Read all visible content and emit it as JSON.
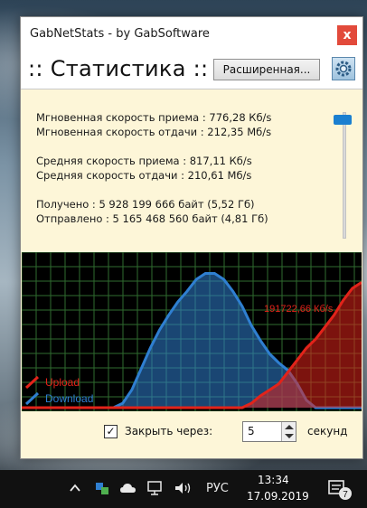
{
  "window": {
    "title": "GabNetStats - by GabSoftware",
    "close_glyph": "x",
    "heading": ":: Статистика ::",
    "advanced_button": "Расширенная..."
  },
  "stats": {
    "instant_rx": "Мгновенная скорость приема : 776,28 Кб/s",
    "instant_tx": "Мгновенная скорость отдачи : 212,35 Мб/s",
    "avg_rx": "Средняя скорость приема : 817,11 Кб/s",
    "avg_tx": "Средняя скорость отдачи : 210,61 Мб/s",
    "received": "Получено : 5 928 199 666 байт (5,52 Гб)",
    "sent": "Отправлено : 5 165 468 560 байт (4,81 Гб)"
  },
  "slider": {
    "level": 0.95
  },
  "graph": {
    "peak_label": "191722,66 Кб/s",
    "legend_upload": "Upload",
    "legend_download": "Download",
    "colors": {
      "upload": "#e2231a",
      "download": "#2f7fd1",
      "grid": "#2f6b2f"
    },
    "download_series": [
      0,
      0,
      0,
      0,
      0,
      0,
      0,
      0,
      0,
      0,
      0,
      0.03,
      0.12,
      0.26,
      0.4,
      0.52,
      0.62,
      0.71,
      0.78,
      0.86,
      0.9,
      0.9,
      0.86,
      0.78,
      0.68,
      0.55,
      0.45,
      0.36,
      0.3,
      0.25,
      0.16,
      0.05,
      0,
      0,
      0,
      0,
      0,
      0
    ],
    "upload_series": [
      0,
      0,
      0,
      0,
      0,
      0,
      0,
      0,
      0,
      0,
      0,
      0,
      0,
      0,
      0,
      0,
      0,
      0,
      0,
      0,
      0,
      0,
      0,
      0,
      0,
      0.03,
      0.08,
      0.12,
      0.16,
      0.24,
      0.32,
      0.4,
      0.46,
      0.54,
      0.62,
      0.72,
      0.8,
      0.84
    ]
  },
  "bottom": {
    "close_checked": true,
    "check_glyph": "✓",
    "close_label": "Закрыть через:",
    "seconds_value": "5",
    "seconds_label": "секунд"
  },
  "taskbar": {
    "language": "РУС",
    "time": "13:34",
    "date": "17.09.2019",
    "notification_count": "7",
    "icons": [
      "chevron-up-icon",
      "network-app-icon",
      "cloud-icon",
      "network-icon",
      "volume-icon",
      "notification-icon"
    ]
  }
}
